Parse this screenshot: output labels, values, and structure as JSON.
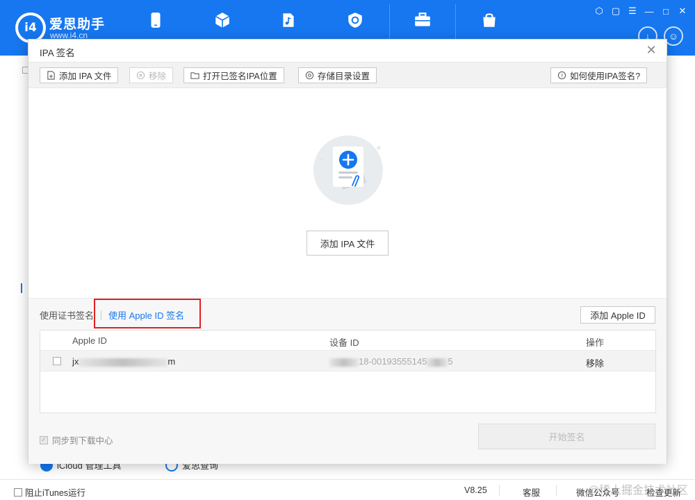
{
  "app": {
    "brand_name": "爱思助手",
    "brand_url": "www.i4.cn",
    "logo_text": "i4",
    "nav_icons": [
      "phone-icon",
      "cube-icon",
      "music-icon",
      "sync-icon",
      "toolbox-icon",
      "bag-icon"
    ],
    "accent_color": "#1677f0"
  },
  "background": {
    "bottom_items": [
      "iCloud 管理工具",
      "爱思查询"
    ]
  },
  "statusbar": {
    "itunes_block_label": "阻止iTunes运行",
    "version": "V8.25",
    "support": "客服",
    "wechat": "微信公众号",
    "check_update": "检查更新"
  },
  "dialog": {
    "title": "IPA 签名",
    "toolbar": {
      "add_ipa": "添加 IPA 文件",
      "remove": "移除",
      "open_signed": "打开已签名IPA位置",
      "storage_settings": "存储目录设置",
      "how_to": "如何使用IPA签名?"
    },
    "center_add_button": "添加 IPA 文件",
    "tabs": {
      "cert_sign": "使用证书签名",
      "appleid_sign": "使用 Apple ID 签名"
    },
    "add_appleid_button": "添加 Apple ID",
    "table": {
      "headers": [
        "Apple ID",
        "设备 ID",
        "操作"
      ],
      "rows": [
        {
          "apple_id_visible": "jx",
          "apple_id_suffix": "m",
          "device_id_visible": "18-00193555145",
          "device_id_suffix": "5",
          "action": "移除"
        }
      ]
    },
    "sync_label": "同步到下载中心",
    "start_button": "开始签名"
  },
  "watermark": "@稀土掘金技术社区"
}
